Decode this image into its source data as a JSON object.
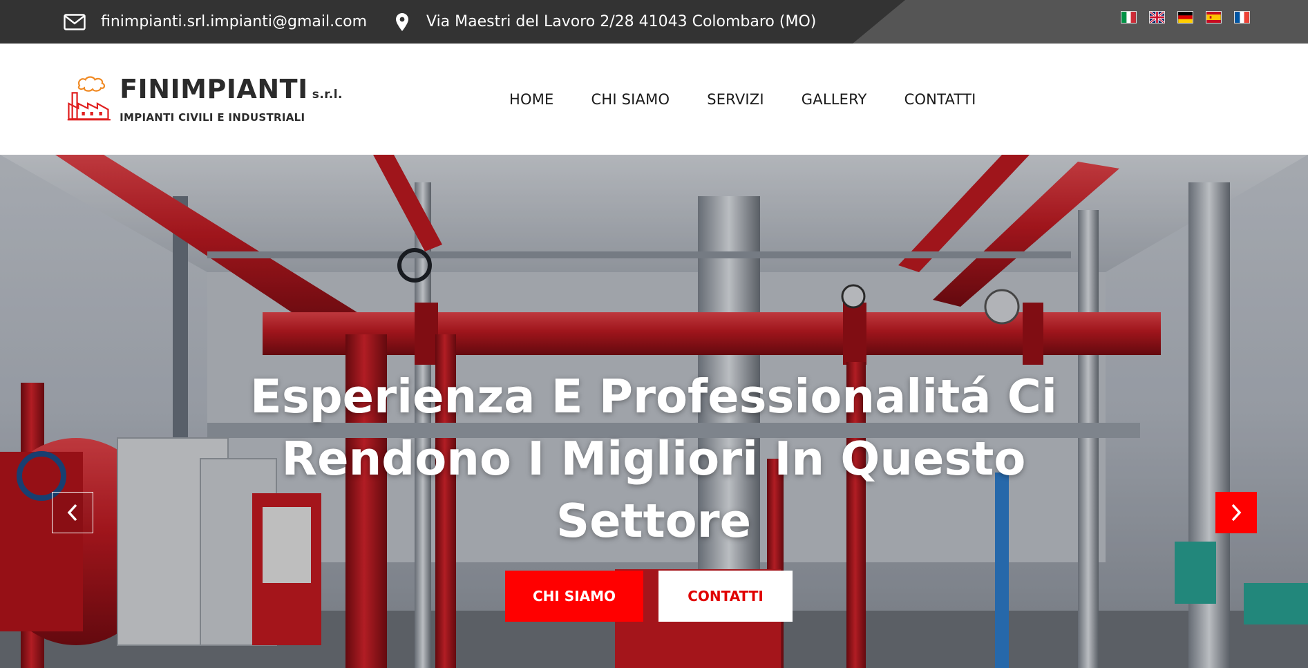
{
  "topbar": {
    "email": "finimpianti.srl.impianti@gmail.com",
    "address": "Via Maestri del Lavoro 2/28 41043 Colombaro (MO)",
    "email_icon": "envelope-icon",
    "address_icon": "map-pin-icon",
    "flags": [
      "flag-italy-icon",
      "flag-uk-icon",
      "flag-germany-icon",
      "flag-spain-icon",
      "flag-france-icon"
    ]
  },
  "brand": {
    "name": "FINIMPIANTI",
    "suffix": "s.r.l.",
    "tagline": "IMPIANTI CIVILI E INDUSTRIALI",
    "logo_icon": "factory-logo-icon"
  },
  "nav": {
    "items": [
      "HOME",
      "CHI SIAMO",
      "SERVIZI",
      "GALLERY",
      "CONTATTI"
    ]
  },
  "hero": {
    "title": "Esperienza E Professionalitá Ci Rendono I Migliori In Questo Settore",
    "primary_button": "CHI SIAMO",
    "secondary_button": "CONTATTI",
    "prev_icon": "chevron-left-icon",
    "next_icon": "chevron-right-icon"
  },
  "colors": {
    "accent": "#ff0000",
    "topbar_dark": "#333333",
    "topbar_light": "#555555",
    "text_dark": "#1a1a1a",
    "white": "#ffffff"
  }
}
